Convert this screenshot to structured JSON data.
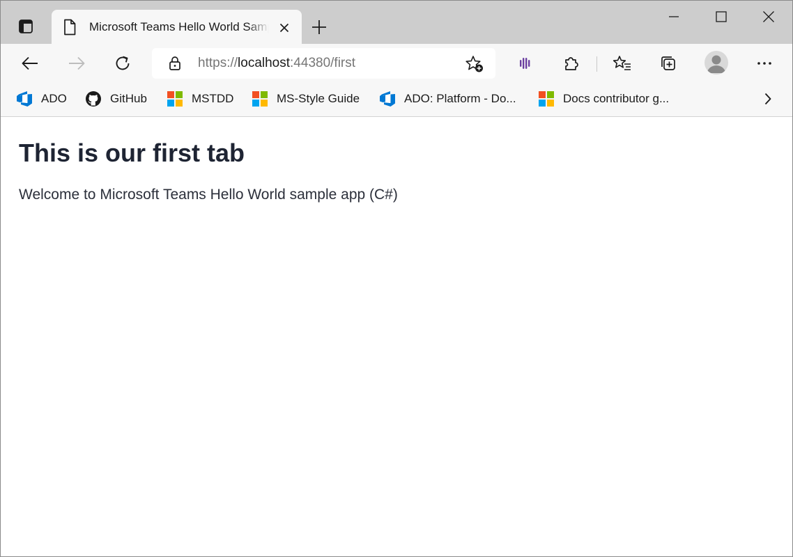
{
  "tab": {
    "title": "Microsoft Teams Hello World Sample"
  },
  "address_bar": {
    "scheme": "https://",
    "host": "localhost",
    "rest": ":44380/first"
  },
  "favorites": [
    {
      "label": "ADO",
      "icon": "azure-devops-icon"
    },
    {
      "label": "GitHub",
      "icon": "github-icon"
    },
    {
      "label": "MSTDD",
      "icon": "microsoft-logo-icon"
    },
    {
      "label": "MS-Style Guide",
      "icon": "microsoft-logo-icon"
    },
    {
      "label": "ADO: Platform - Do...",
      "icon": "azure-devops-icon"
    },
    {
      "label": "Docs contributor g...",
      "icon": "microsoft-logo-icon"
    }
  ],
  "page": {
    "heading": "This is our first tab",
    "text": "Welcome to Microsoft Teams Hello World sample app (C#)"
  },
  "colors": {
    "tab_strip": "#cdcdcd",
    "toolbar": "#f7f7f7",
    "azure_blue": "#0078d4",
    "ms_red": "#f25022",
    "ms_green": "#7fba00",
    "ms_blue": "#00a4ef",
    "ms_yellow": "#ffb900",
    "extension_purple": "#6b3fa0"
  }
}
